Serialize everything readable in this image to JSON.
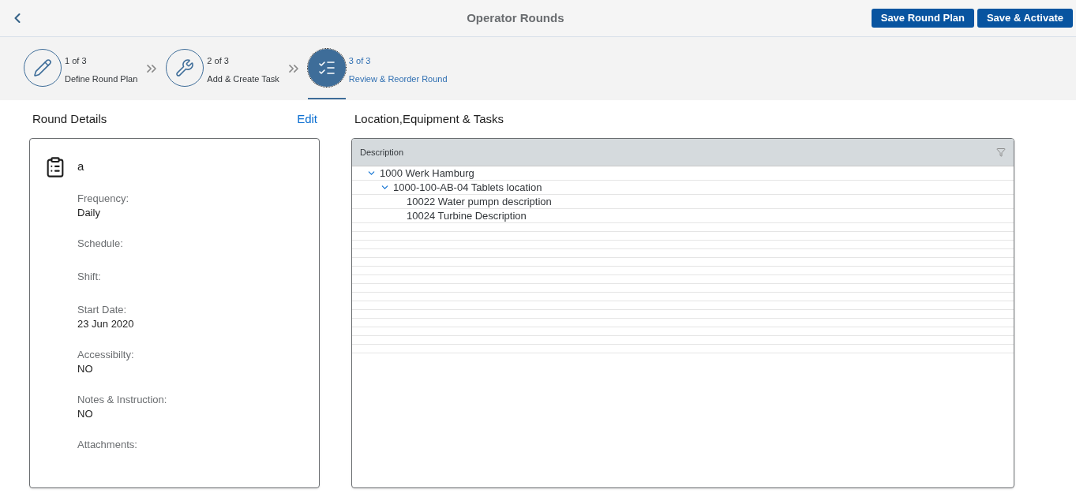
{
  "header": {
    "title": "Operator Rounds",
    "buttons": [
      "Save Round Plan",
      "Save & Activate"
    ]
  },
  "steps": [
    {
      "number": "1 of 3",
      "label": "Define Round Plan",
      "selected": false
    },
    {
      "number": "2 of 3",
      "label": "Add & Create Task",
      "selected": false
    },
    {
      "number": "3 of 3",
      "label": "Review & Reorder Round",
      "selected": true
    }
  ],
  "round_details": {
    "title": "Round Details",
    "edit_link": "Edit",
    "name": "a",
    "fields": [
      {
        "label": "Frequency:",
        "value": "Daily"
      },
      {
        "label": "Schedule:"
      },
      {
        "label": "Shift:"
      },
      {
        "label": "Start Date:",
        "value": "23 Jun 2020"
      },
      {
        "label": "Accessibilty:",
        "value": "NO"
      },
      {
        "label": "Notes & Instruction:",
        "value": "NO"
      },
      {
        "label": "Attachments:"
      }
    ]
  },
  "tasks": {
    "title": "Location,Equipment & Tasks",
    "column": "Description",
    "tree": [
      {
        "label": "1000 Werk Hamburg",
        "expanded": true,
        "children": [
          {
            "label": "1000-100-AB-04 Tablets location",
            "expanded": true,
            "children": [
              {
                "label": "10022 Water pumpn description"
              },
              {
                "label": "10024 Turbine Description"
              }
            ]
          }
        ]
      }
    ]
  }
}
